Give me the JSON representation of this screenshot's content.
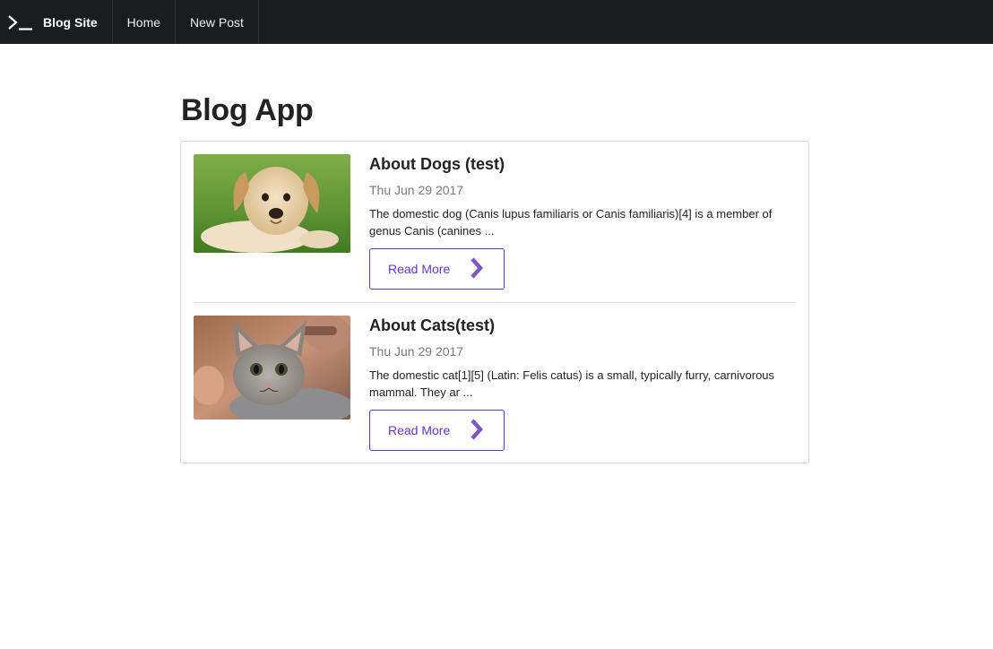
{
  "nav": {
    "brand": "Blog Site",
    "items": [
      {
        "label": "Home"
      },
      {
        "label": "New Post"
      }
    ],
    "logo_icon": "terminal-prompt-icon",
    "background": "#1b1c1d"
  },
  "page": {
    "title": "Blog App"
  },
  "posts": [
    {
      "title": "About Dogs (test)",
      "date": "Thu Jun 29 2017",
      "excerpt": "The domestic dog (Canis lupus familiaris or Canis familiaris)[4] is a member of genus Canis (canines ...",
      "button_label": "Read More",
      "image": "puppy-photo"
    },
    {
      "title": "About Cats(test)",
      "date": "Thu Jun 29 2017",
      "excerpt": "The domestic cat[1][5] (Latin: Felis catus) is a small, typically furry, carnivorous mammal. They ar ...",
      "button_label": "Read More",
      "image": "kitten-photo"
    }
  ],
  "colors": {
    "accent": "#6435c9",
    "chevron": "#7e57c2",
    "text": "#222222",
    "muted": "#7a7a7a",
    "border": "#d4d4d5"
  }
}
